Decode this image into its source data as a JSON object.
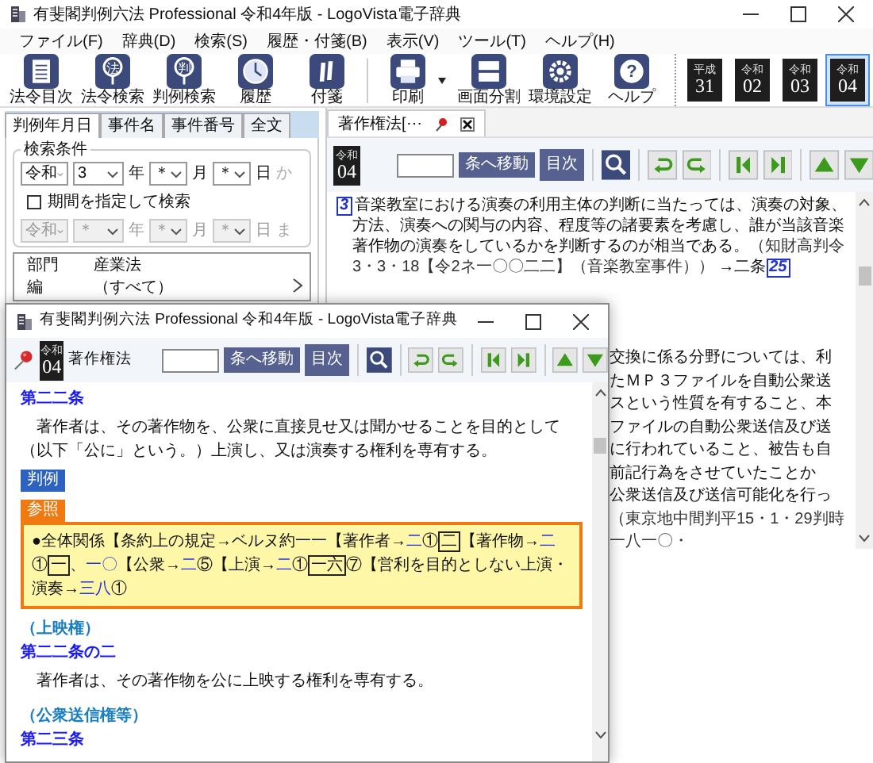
{
  "window": {
    "title": "有斐閣判例六法 Professional 令和4年版 - LogoVista電子辞典"
  },
  "menu": [
    "ファイル(F)",
    "辞典(D)",
    "検索(S)",
    "履歴・付箋(B)",
    "表示(V)",
    "ツール(T)",
    "ヘルプ(H)"
  ],
  "toolbar": {
    "buttons": [
      {
        "label": "法令目次",
        "kind": "toc"
      },
      {
        "label": "法令検索",
        "kind": "glyph_search",
        "glyph": "法"
      },
      {
        "label": "判例検索",
        "kind": "glyph_search",
        "glyph": "判"
      },
      {
        "label": "履歴",
        "kind": "history"
      },
      {
        "label": "付箋",
        "kind": "tags"
      },
      {
        "label": "印刷",
        "kind": "print",
        "dropdown": true
      },
      {
        "label": "画面分割",
        "kind": "split"
      },
      {
        "label": "環境設定",
        "kind": "settings"
      },
      {
        "label": "ヘルプ",
        "kind": "help",
        "glyph": "?"
      }
    ],
    "eras": [
      {
        "era": "平成",
        "year": "31",
        "selected": false
      },
      {
        "era": "令和",
        "year": "02",
        "selected": false
      },
      {
        "era": "令和",
        "year": "03",
        "selected": false
      },
      {
        "era": "令和",
        "year": "04",
        "selected": true
      }
    ]
  },
  "search_panel": {
    "tabs": [
      {
        "label": "判例年月日",
        "selected": true
      },
      {
        "label": "事件名",
        "selected": false
      },
      {
        "label": "事件番号",
        "selected": false
      },
      {
        "label": "全文",
        "selected": false
      }
    ],
    "group_title": "検索条件",
    "from": {
      "era": "令和",
      "year": "3",
      "year_label": "年",
      "month": "＊",
      "month_label": "月",
      "day": "＊",
      "day_label": "日",
      "suffix": "か",
      "disabled": false
    },
    "period": {
      "label": "期間を指定して検索",
      "checked": false
    },
    "to": {
      "era": "令和",
      "year": "＊",
      "year_label": "年",
      "month": "＊",
      "month_label": "月",
      "day": "＊",
      "day_label": "日",
      "suffix": "ま",
      "disabled": true
    },
    "filters": [
      {
        "name": "部門",
        "value": "産業法"
      },
      {
        "name": "編",
        "value": "（すべて）"
      }
    ]
  },
  "law_pane": {
    "tab": "著作権法[⋯",
    "era_badge": {
      "era": "令和",
      "year": "04"
    },
    "jump_button": "条へ移動",
    "toc_button": "目次",
    "case": {
      "number": "3",
      "text": "音楽教室における演奏の利用主体の判断に当たっては、演奏の対象、方法、演奏への関与の内容、程度等の諸要素を考慮し、誰が当該音楽著作物の演奏をしているかを判断するのが相当である。",
      "citation": "（知財高判令3・3・18【令2ネ一〇〇二二】（音楽教室事件））",
      "crossref": "→二条",
      "crossref_link": "25"
    },
    "partial_lines": [
      "交換に係る分野については、利",
      "たＭＰ３ファイルを自動公衆送",
      "スという性質を有すること、本",
      "ファイルの自動公衆送信及び送",
      "に行われていること、被告も自",
      "前記行為をさせていたことか",
      "公衆送信及び送信可能化を行っ",
      "（東京地中間判平15・1・29判時一八一〇・"
    ]
  },
  "popup": {
    "title": "有斐閣判例六法 Professional 令和4年版 - LogoVista電子辞典",
    "era_badge": {
      "era": "令和",
      "year": "04"
    },
    "law_name": "著作権法",
    "jump_button": "条へ移動",
    "toc_button": "目次",
    "content": [
      {
        "kind": "article",
        "text": "第二二条"
      },
      {
        "kind": "paragraph",
        "text": "著作者は、その著作物を、公衆に直接見せ又は聞かせることを目的として（以下「公に」という。）上演し、又は演奏する権利を専有する。"
      },
      {
        "kind": "label",
        "text": "判例"
      },
      {
        "kind": "reference",
        "tab": "参照",
        "segments": [
          {
            "kind": "text",
            "text": "●全体関係【条約上の規定→ベルヌ約一一【著作者→"
          },
          {
            "kind": "link",
            "text": "二"
          },
          {
            "kind": "text",
            "text": "①"
          },
          {
            "kind": "boxed",
            "text": "二"
          },
          {
            "kind": "text",
            "text": "【著作物→"
          },
          {
            "kind": "link",
            "text": "二"
          },
          {
            "kind": "text",
            "text": "①"
          },
          {
            "kind": "boxed",
            "text": "一"
          },
          {
            "kind": "text",
            "text": "、"
          },
          {
            "kind": "link",
            "text": "一〇"
          },
          {
            "kind": "text",
            "text": "【公衆→"
          },
          {
            "kind": "link",
            "text": "二"
          },
          {
            "kind": "text",
            "text": "⑤【上演→"
          },
          {
            "kind": "link",
            "text": "二"
          },
          {
            "kind": "text",
            "text": "①"
          },
          {
            "kind": "boxed",
            "text": "一六"
          },
          {
            "kind": "text",
            "text": "⑦【営利を目的としない上演・演奏→"
          },
          {
            "kind": "link",
            "text": "三八"
          },
          {
            "kind": "text",
            "text": "①"
          }
        ]
      },
      {
        "kind": "caption",
        "text": "（上映権）"
      },
      {
        "kind": "article",
        "text": "第二二条の二"
      },
      {
        "kind": "paragraph",
        "text": "著作者は、その著作物を公に上映する権利を専有する。"
      },
      {
        "kind": "caption",
        "text": "（公衆送信権等）"
      },
      {
        "kind": "article",
        "text": "第二三条"
      }
    ]
  }
}
